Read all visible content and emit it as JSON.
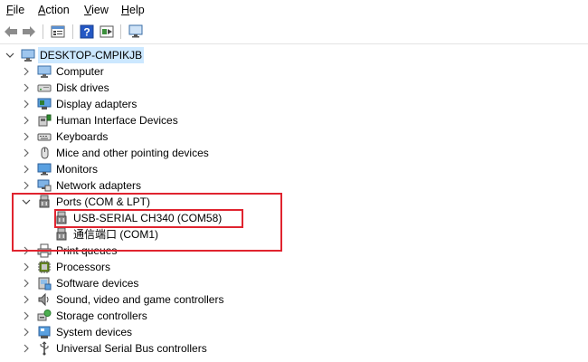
{
  "menu": {
    "file": {
      "u": "F",
      "rest": "ile"
    },
    "action": {
      "u": "A",
      "rest": "ction"
    },
    "view": {
      "u": "V",
      "rest": "iew"
    },
    "help": {
      "u": "H",
      "rest": "elp"
    }
  },
  "toolbar": {
    "icons": [
      "back-icon",
      "forward-icon",
      "properties-icon",
      "help-icon",
      "run-icon",
      "monitor-icon"
    ]
  },
  "tree": {
    "root": "DESKTOP-CMPIKJB",
    "items": [
      {
        "label": "Computer",
        "icon": "computer-icon",
        "expanded": false
      },
      {
        "label": "Disk drives",
        "icon": "disk-drive-icon",
        "expanded": false
      },
      {
        "label": "Display adapters",
        "icon": "display-adapter-icon",
        "expanded": false
      },
      {
        "label": "Human Interface Devices",
        "icon": "hid-icon",
        "expanded": false
      },
      {
        "label": "Keyboards",
        "icon": "keyboard-icon",
        "expanded": false
      },
      {
        "label": "Mice and other pointing devices",
        "icon": "mouse-icon",
        "expanded": false
      },
      {
        "label": "Monitors",
        "icon": "monitor-icon",
        "expanded": false
      },
      {
        "label": "Network adapters",
        "icon": "network-adapter-icon",
        "expanded": false
      },
      {
        "label": "Ports (COM & LPT)",
        "icon": "port-icon",
        "expanded": true,
        "children": [
          {
            "label": "USB-SERIAL CH340 (COM58)",
            "icon": "port-icon"
          },
          {
            "label": "通信端口 (COM1)",
            "icon": "port-icon"
          }
        ]
      },
      {
        "label": "Print queues",
        "icon": "printer-icon",
        "expanded": false
      },
      {
        "label": "Processors",
        "icon": "processor-icon",
        "expanded": false
      },
      {
        "label": "Software devices",
        "icon": "software-device-icon",
        "expanded": false
      },
      {
        "label": "Sound, video and game controllers",
        "icon": "speaker-icon",
        "expanded": false
      },
      {
        "label": "Storage controllers",
        "icon": "storage-controller-icon",
        "expanded": false
      },
      {
        "label": "System devices",
        "icon": "system-device-icon",
        "expanded": false
      },
      {
        "label": "Universal Serial Bus controllers",
        "icon": "usb-icon",
        "expanded": false
      }
    ]
  },
  "colors": {
    "highlight_border": "#e0242f",
    "root_selection": "#cce8ff"
  }
}
